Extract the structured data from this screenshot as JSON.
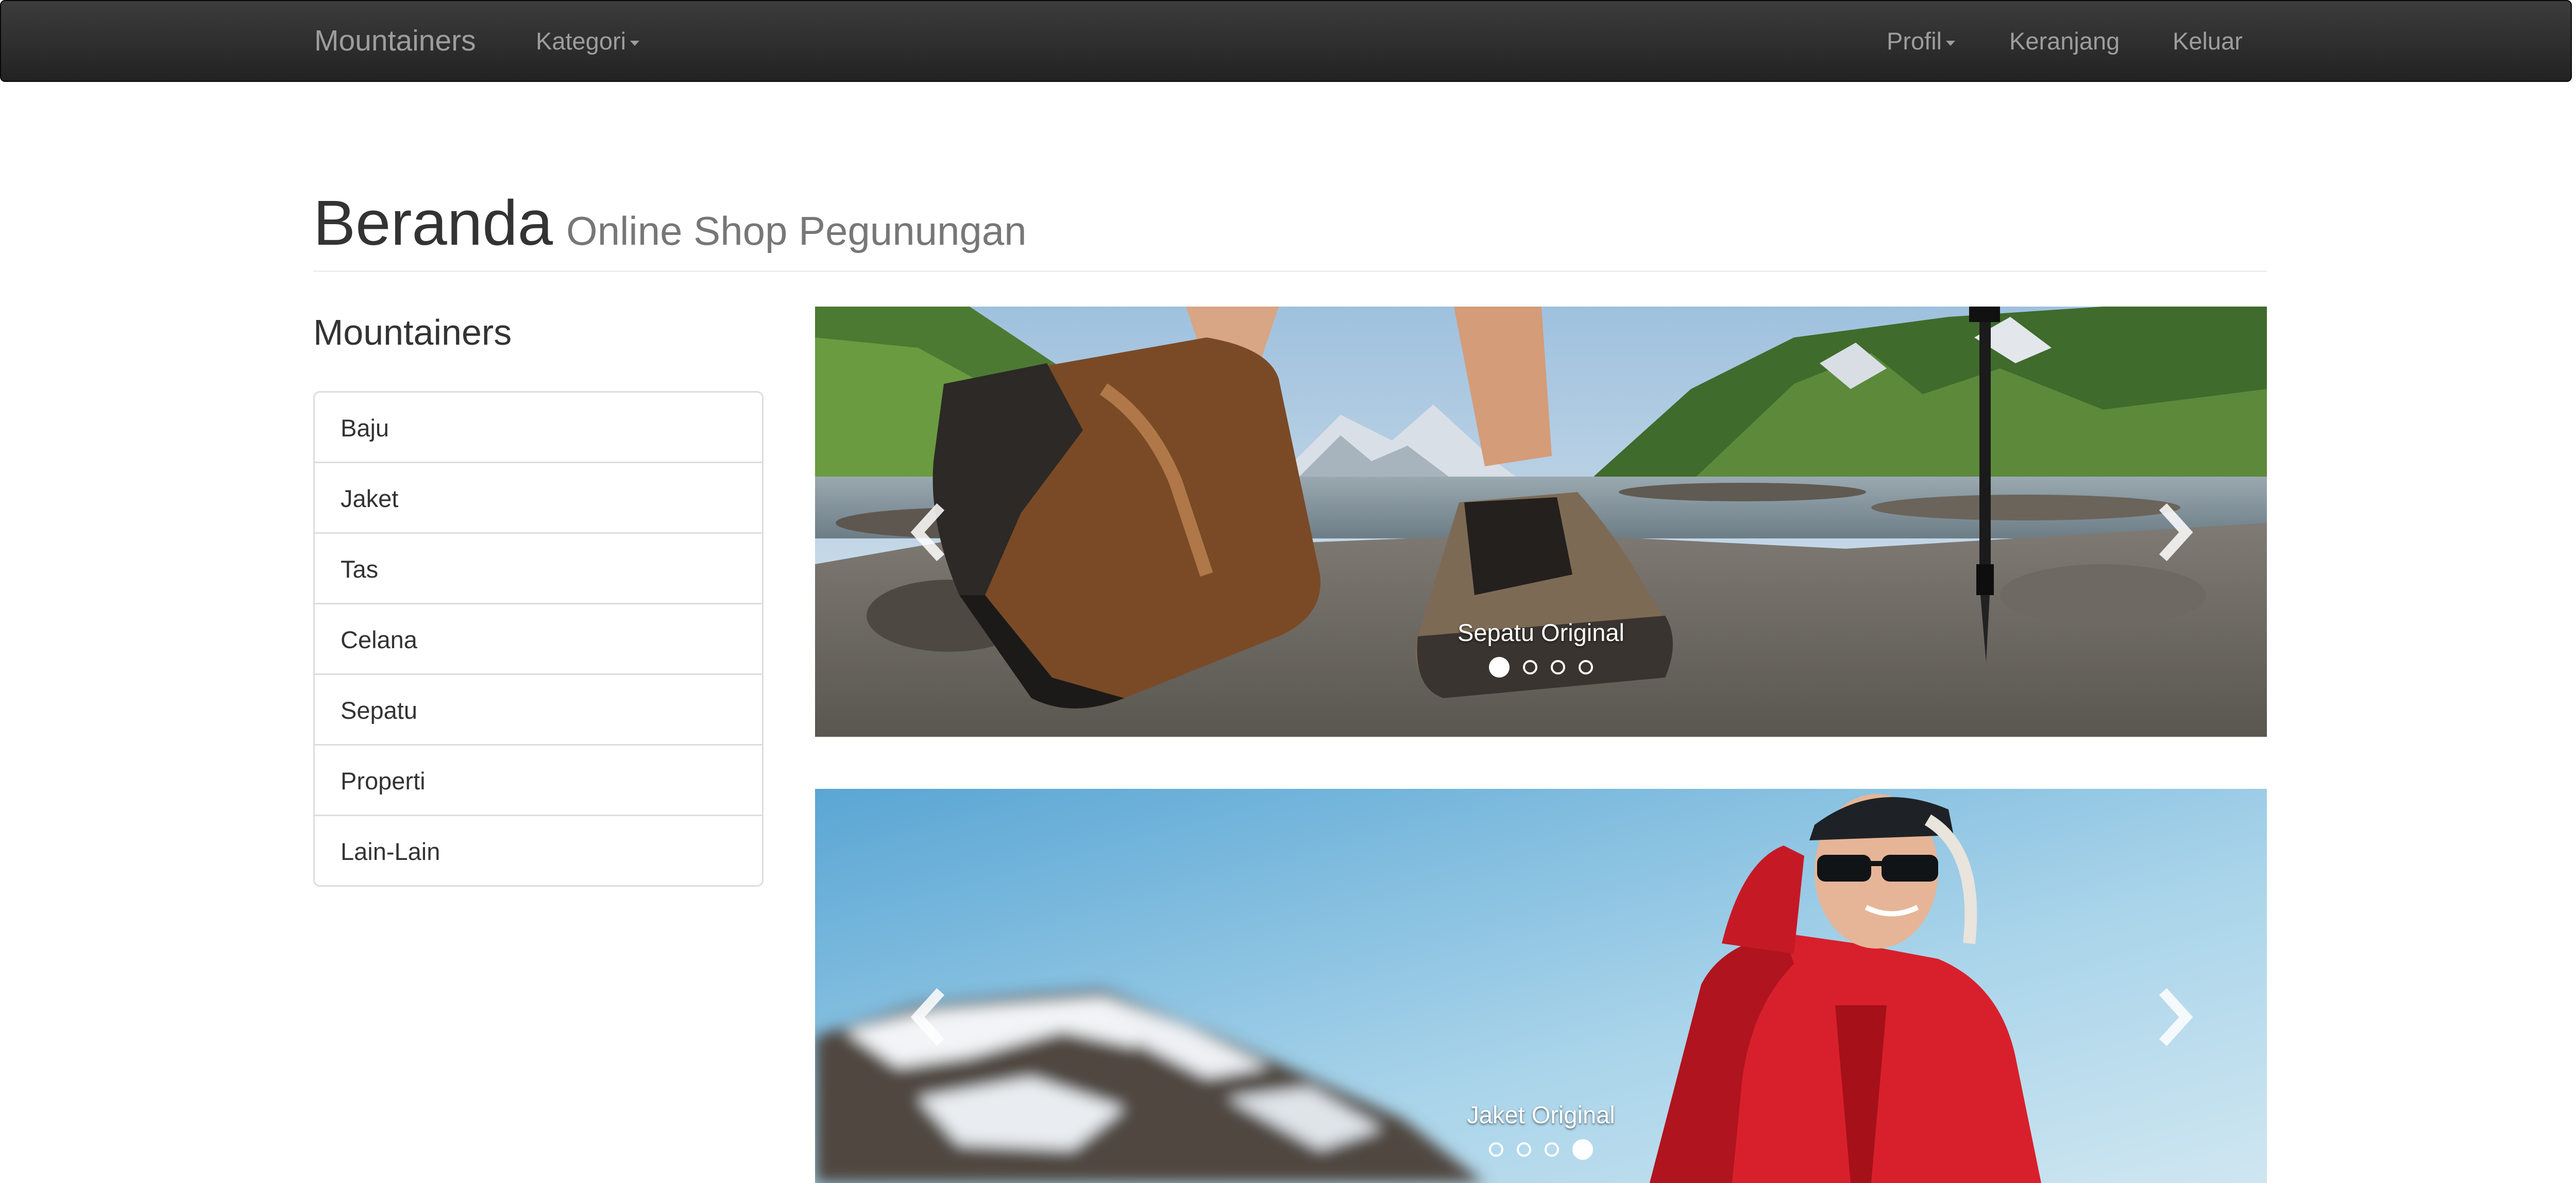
{
  "navbar": {
    "brand": "Mountainers",
    "kategori": "Kategori",
    "profil": "Profil",
    "keranjang": "Keranjang",
    "keluar": "Keluar"
  },
  "header": {
    "title": "Beranda",
    "subtitle": "Online Shop Pegunungan"
  },
  "sidebar": {
    "title": "Mountainers",
    "items": [
      {
        "label": "Baju"
      },
      {
        "label": "Jaket"
      },
      {
        "label": "Tas"
      },
      {
        "label": "Celana"
      },
      {
        "label": "Sepatu"
      },
      {
        "label": "Properti"
      },
      {
        "label": "Lain-Lain"
      }
    ]
  },
  "carousels": [
    {
      "caption": "Sepatu Original",
      "active_index": 0,
      "slide_count": 4
    },
    {
      "caption": "Jaket Original",
      "active_index": 3,
      "slide_count": 4
    }
  ],
  "colors": {
    "navbar_bg": "#222222",
    "navbar_text": "#9d9d9d",
    "subtitle_text": "#777777",
    "border": "#dddddd"
  },
  "icons": {
    "prev": "chevron-left-icon",
    "next": "chevron-right-icon",
    "dropdown": "caret-down-icon"
  }
}
